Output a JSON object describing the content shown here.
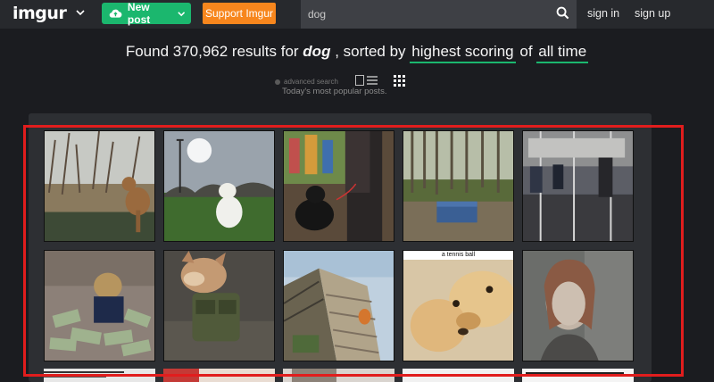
{
  "header": {
    "logo": "imgur",
    "new_post": "New post",
    "support": "Support Imgur",
    "search_value": "dog",
    "sign_in": "sign in",
    "sign_up": "sign up"
  },
  "results": {
    "prefix": "Found 370,962 results for",
    "query": "dog",
    "middle": ", sorted by",
    "sort": "highest scoring",
    "of": "of",
    "time": "all time"
  },
  "options": {
    "advanced": "advanced search",
    "popular": "Today's most popular posts."
  },
  "gallery": {
    "captions": {
      "tennis": "a tennis ball"
    }
  },
  "colors": {
    "accent_green": "#1bb76e",
    "accent_orange": "#f7861d",
    "highlight_red": "#e11d1d"
  }
}
